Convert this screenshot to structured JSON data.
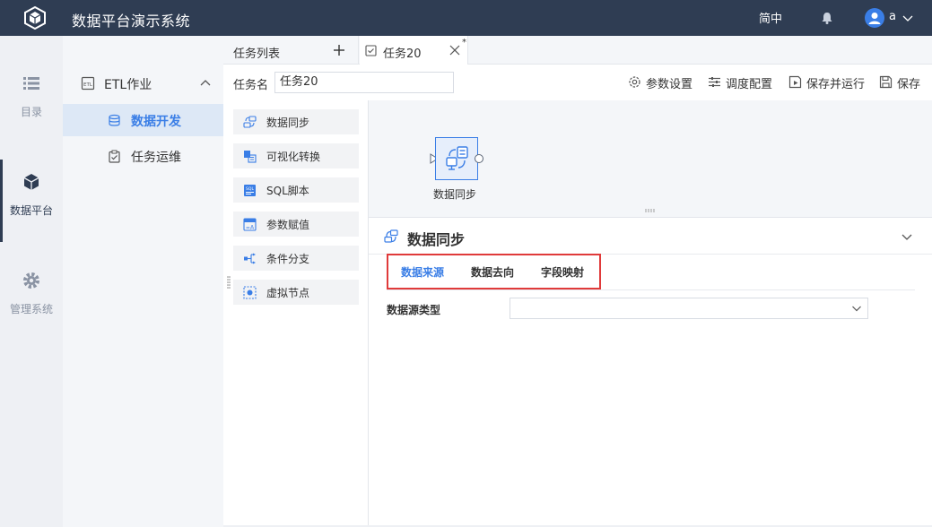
{
  "header": {
    "app_title": "数据平台演示系统",
    "language": "简中",
    "user": "a"
  },
  "rail": {
    "items": [
      {
        "label": "目录",
        "icon": "list-icon"
      },
      {
        "label": "数据平台",
        "icon": "cube-icon",
        "active": true
      },
      {
        "label": "管理系统",
        "icon": "gear-icon"
      }
    ]
  },
  "submenu": {
    "group": "ETL作业",
    "items": [
      {
        "label": "数据开发",
        "active": true
      },
      {
        "label": "任务运维"
      }
    ]
  },
  "tabs": {
    "list_label": "任务列表",
    "active_tab": "任务20",
    "modified_mark": "*"
  },
  "taskbar": {
    "name_label": "任务名",
    "name_value": "任务20",
    "tools": [
      "参数设置",
      "调度配置",
      "保存并运行",
      "保存"
    ]
  },
  "palette": {
    "items": [
      "数据同步",
      "可视化转换",
      "SQL脚本",
      "参数赋值",
      "条件分支",
      "虚拟节点"
    ]
  },
  "canvas": {
    "node_label": "数据同步"
  },
  "panel": {
    "title": "数据同步",
    "subtabs": [
      "数据来源",
      "数据去向",
      "字段映射"
    ],
    "field_label": "数据源类型",
    "field_value": ""
  },
  "colors": {
    "header_bg": "#2f3d53",
    "accent": "#3a7ee6",
    "highlight_box": "#e03a3a"
  }
}
